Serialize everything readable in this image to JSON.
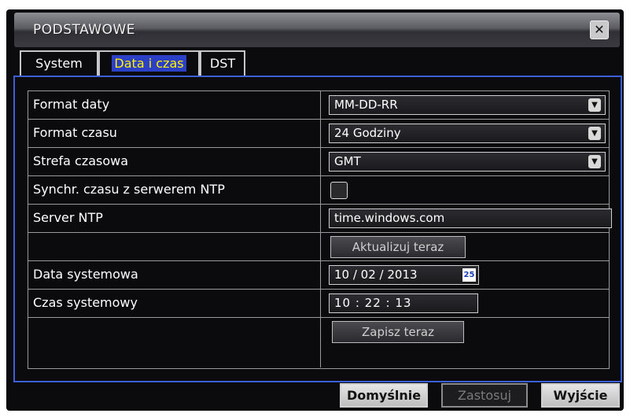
{
  "dialog": {
    "title": "PODSTAWOWE",
    "close_symbol": "✕"
  },
  "tabs": [
    {
      "label": "System",
      "active": false
    },
    {
      "label": "Data i czas",
      "active": true
    },
    {
      "label": "DST",
      "active": false
    }
  ],
  "settings": {
    "date_format": {
      "label": "Format daty",
      "value": "MM-DD-RR"
    },
    "time_format": {
      "label": "Format czasu",
      "value": "24 Godziny"
    },
    "time_zone": {
      "label": "Strefa czasowa",
      "value": "GMT"
    },
    "ntp_sync": {
      "label": "Synchr. czasu z serwerem NTP",
      "checked": false
    },
    "ntp_server": {
      "label": "Server NTP",
      "value": "time.windows.com"
    },
    "update_now": {
      "label": "Aktualizuj teraz"
    },
    "system_date": {
      "label": "Data systemowa",
      "value": "10 / 02 / 2013",
      "calendar_number": "25"
    },
    "system_time": {
      "label": "Czas systemowy",
      "value": "10 : 22 : 13"
    },
    "save_now": {
      "label": "Zapisz teraz"
    }
  },
  "footer": {
    "default_label": "Domyślnie",
    "apply_label": "Zastosuj",
    "exit_label": "Wyjście"
  },
  "colors": {
    "active_tab_bg": "#2b3fc7",
    "active_tab_text": "#fff200",
    "panel_border": "#3d5fd6"
  }
}
